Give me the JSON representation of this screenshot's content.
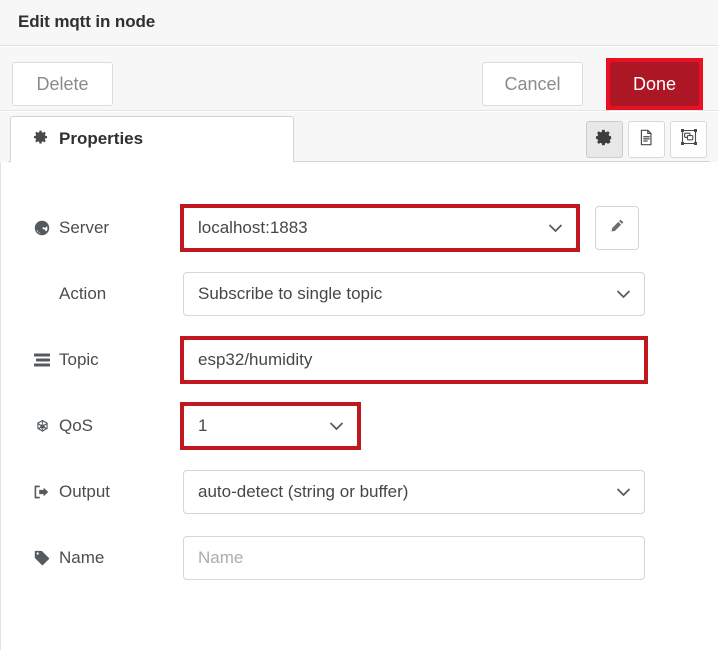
{
  "dialog": {
    "title": "Edit mqtt in node"
  },
  "toolbar": {
    "delete_label": "Delete",
    "cancel_label": "Cancel",
    "done_label": "Done"
  },
  "tabs": [
    {
      "label": "Properties",
      "icon": "gear-icon",
      "active": true
    }
  ],
  "tab_actions": [
    {
      "icon": "gear-icon",
      "active": true
    },
    {
      "icon": "description-icon",
      "active": false
    },
    {
      "icon": "appearance-icon",
      "active": false
    }
  ],
  "form": {
    "server": {
      "label": "Server",
      "icon": "globe-icon",
      "value": "localhost:1883",
      "highlighted": true,
      "edit_button_icon": "pencil-icon"
    },
    "action": {
      "label": "Action",
      "icon": "none",
      "value": "Subscribe to single topic",
      "highlighted": false
    },
    "topic": {
      "label": "Topic",
      "icon": "tasks-icon",
      "value": "esp32/humidity",
      "highlighted": true
    },
    "qos": {
      "label": "QoS",
      "icon": "empire-icon",
      "value": "1",
      "highlighted": true
    },
    "output": {
      "label": "Output",
      "icon": "sign-out-icon",
      "value": "auto-detect (string or buffer)",
      "highlighted": false
    },
    "name": {
      "label": "Name",
      "icon": "tag-icon",
      "value": "",
      "placeholder": "Name",
      "highlighted": false
    }
  },
  "colors": {
    "annotation": "#c0181f",
    "done_button": "#ad1625",
    "done_highlight": "#e81123",
    "header_bg": "#f7f7f7",
    "text": "#4d4d4d"
  }
}
